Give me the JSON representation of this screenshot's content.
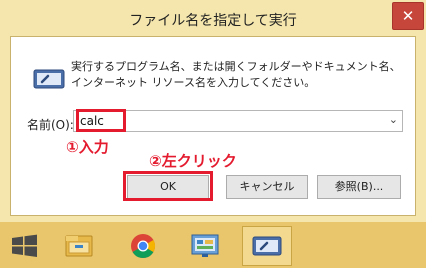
{
  "dialog": {
    "title": "ファイル名を指定して実行",
    "close_label": "✕",
    "description": "実行するプログラム名、または開くフォルダーやドキュメント名、インターネット リソース名を入力してください。",
    "name_label": "名前(O):",
    "name_value": "calc",
    "buttons": {
      "ok": "OK",
      "cancel": "キャンセル",
      "browse": "参照(B)..."
    }
  },
  "annotations": {
    "step1": "①入力",
    "step2": "②左クリック"
  },
  "taskbar": {
    "items": [
      {
        "icon": "start-windows-icon"
      },
      {
        "icon": "file-explorer-icon"
      },
      {
        "icon": "chrome-icon"
      },
      {
        "icon": "control-panel-icon"
      },
      {
        "icon": "run-dialog-icon",
        "active": true
      }
    ]
  },
  "colors": {
    "accent_red": "#e41b2f",
    "window_frame": "#f4e6ad",
    "taskbar": "#e9c66c"
  }
}
